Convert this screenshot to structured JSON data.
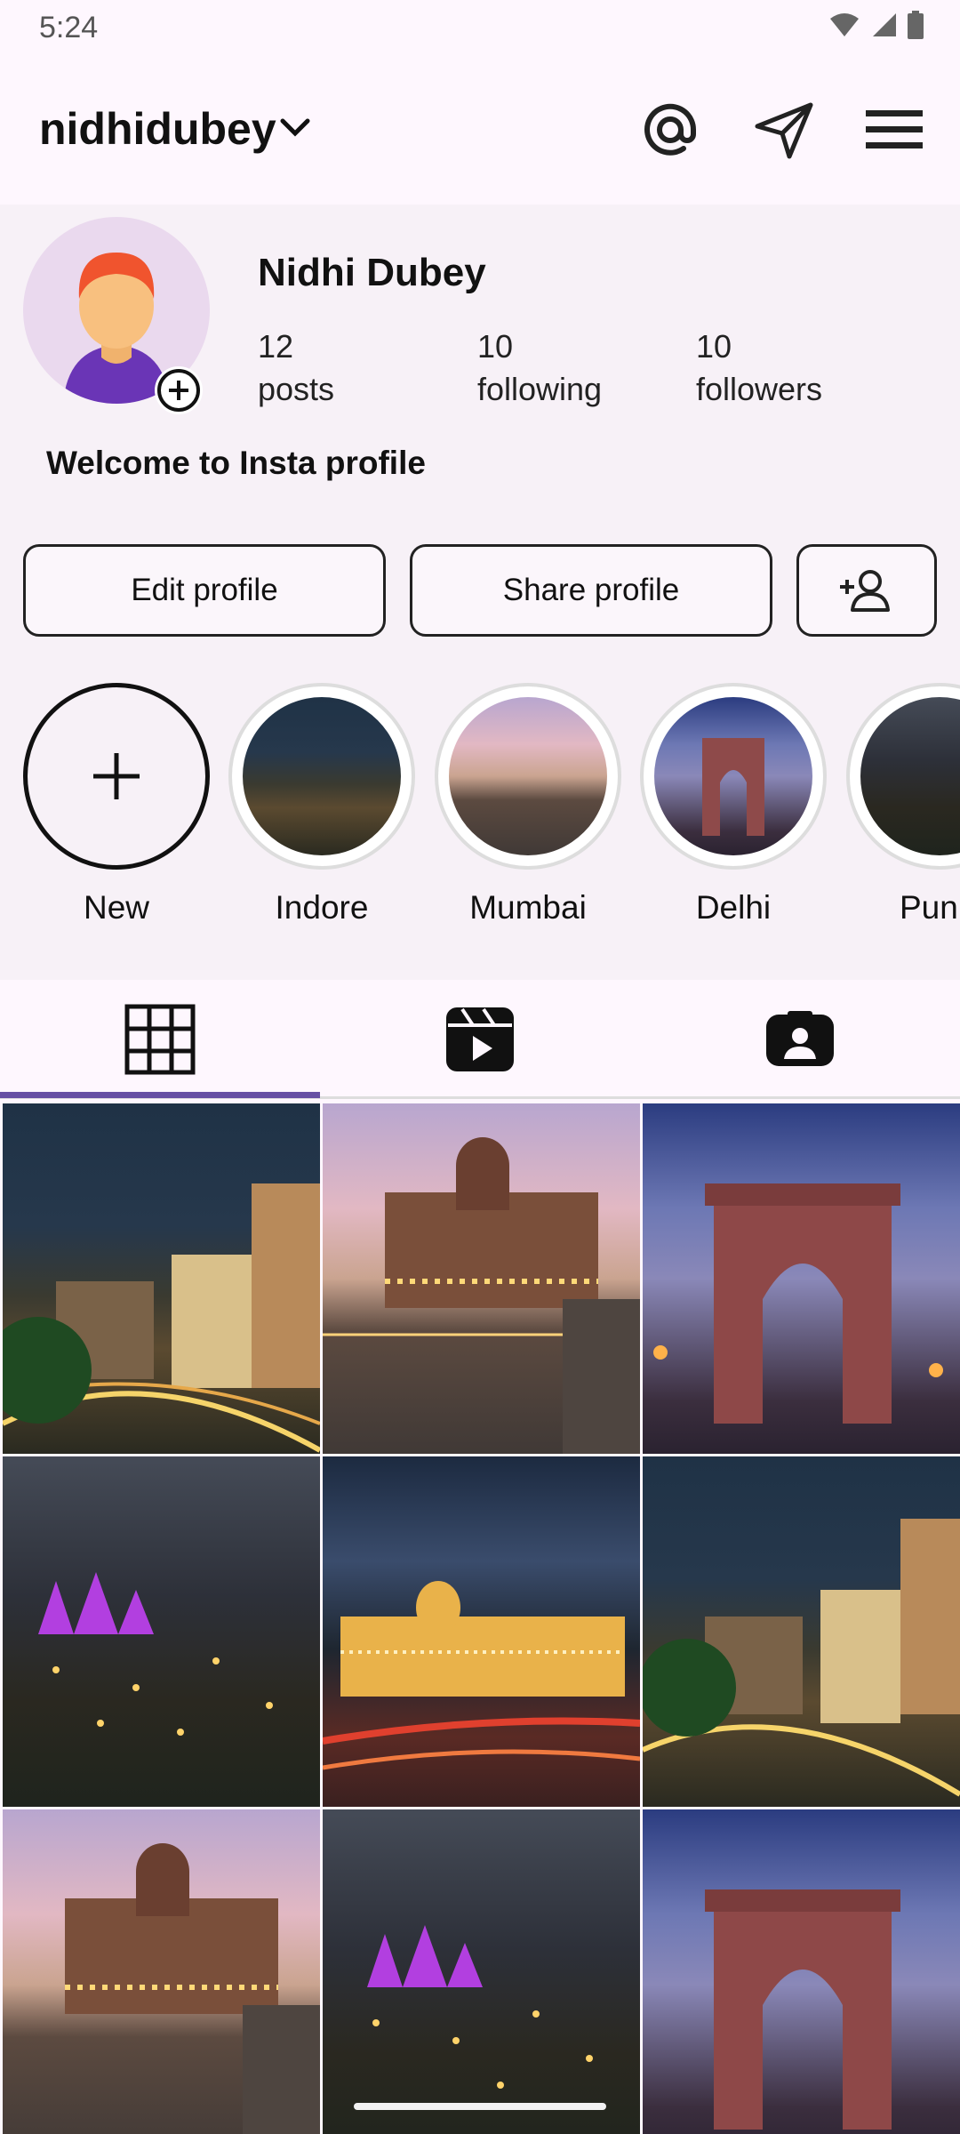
{
  "status_bar": {
    "time": "5:24"
  },
  "header": {
    "username": "nidhidubey"
  },
  "profile": {
    "name": "Nidhi Dubey",
    "stats": [
      {
        "value": "12",
        "label": "posts"
      },
      {
        "value": "10",
        "label": "following"
      },
      {
        "value": "10",
        "label": "followers"
      }
    ],
    "bio": "Welcome to Insta profile"
  },
  "actions": {
    "edit_label": "Edit profile",
    "share_label": "Share profile"
  },
  "highlights": [
    {
      "label": "New"
    },
    {
      "label": "Indore"
    },
    {
      "label": "Mumbai"
    },
    {
      "label": "Delhi"
    },
    {
      "label": "Pun"
    }
  ],
  "tabs": [
    {
      "icon": "grid-icon",
      "active": true
    },
    {
      "icon": "reels-icon",
      "active": false
    },
    {
      "icon": "tagged-icon",
      "active": false
    }
  ],
  "grid": [
    {
      "scene": "indore"
    },
    {
      "scene": "mumbai"
    },
    {
      "scene": "delhi"
    },
    {
      "scene": "pune"
    },
    {
      "scene": "mysore"
    },
    {
      "scene": "indore"
    },
    {
      "scene": "mumbai"
    },
    {
      "scene": "pune"
    },
    {
      "scene": "delhi"
    }
  ],
  "colors": {
    "accent": "#6750a4",
    "background": "#fef7fe",
    "profile_bg": "#f7f1f7"
  }
}
